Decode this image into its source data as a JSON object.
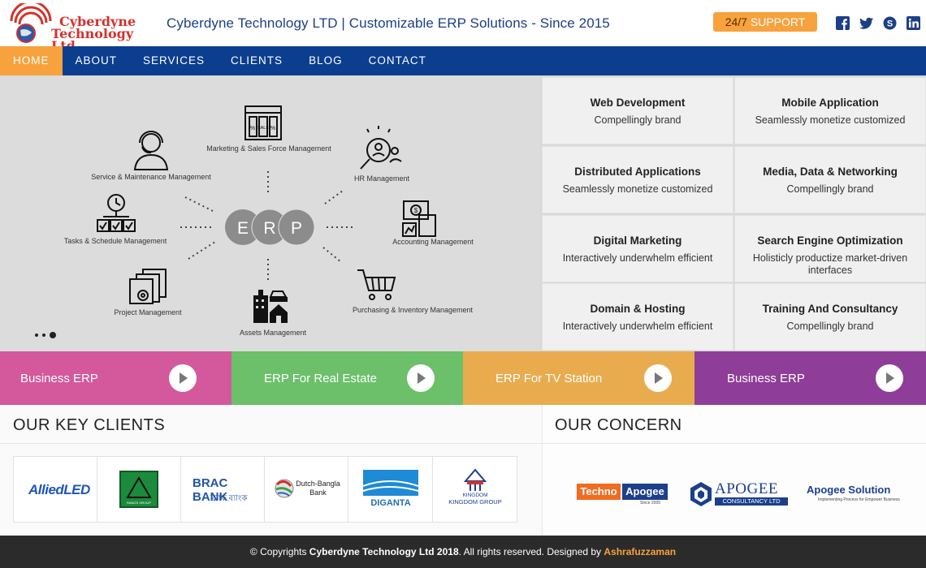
{
  "brand": {
    "name_line1": "Cyberdyne",
    "name_line2": "Technology Ltd.",
    "tagline": "Cyberdyne Technology LTD | Customizable ERP Solutions - Since 2015"
  },
  "support": {
    "prefix": "24/7",
    "label": "SUPPORT"
  },
  "social": [
    "facebook-icon",
    "twitter-icon",
    "skype-icon",
    "linkedin-icon"
  ],
  "nav": [
    {
      "label": "HOME",
      "active": true
    },
    {
      "label": "ABOUT"
    },
    {
      "label": "SERVICES"
    },
    {
      "label": "CLIENTS"
    },
    {
      "label": "BLOG"
    },
    {
      "label": "CONTACT"
    }
  ],
  "hero": {
    "center": [
      "E",
      "R",
      "P"
    ],
    "modules": [
      "Service & Maintenance Management",
      "Marketing & Sales Force Management",
      "HR Management",
      "Tasks & Schedule Management",
      "Accounting Management",
      "Project Management",
      "Assets Management",
      "Purchasing & Inventory Management"
    ]
  },
  "services": [
    {
      "title": "Web Development",
      "sub": "Compellingly brand"
    },
    {
      "title": "Mobile Application",
      "sub": "Seamlessly monetize customized"
    },
    {
      "title": "Distributed Applications",
      "sub": "Seamlessly monetize customized"
    },
    {
      "title": "Media, Data & Networking",
      "sub": "Compellingly brand"
    },
    {
      "title": "Digital Marketing",
      "sub": "Interactively underwhelm efficient"
    },
    {
      "title": "Search Engine Optimization",
      "sub": "Holisticly productize market-driven interfaces"
    },
    {
      "title": "Domain & Hosting",
      "sub": "Interactively underwhelm efficient"
    },
    {
      "title": "Training And Consultancy",
      "sub": "Compellingly brand"
    }
  ],
  "categories": [
    {
      "label": "Business ERP",
      "color": "#d3599c"
    },
    {
      "label": "ERP For Real Estate",
      "color": "#6cc06a"
    },
    {
      "label": "ERP For TV Station",
      "color": "#e8ac4e"
    },
    {
      "label": "Business ERP",
      "color": "#8e3d98"
    }
  ],
  "clients": {
    "title": "OUR KEY CLIENTS",
    "logos": [
      "AlliedLED",
      "RANGS GROUP",
      "BRAC BANK",
      "Dutch-Bangla Bank",
      "DIGANTA",
      "KINGDOM GROUP"
    ],
    "brac_sub": "ব্র্যাক ব্যাংক",
    "kingdom_sub": "KINGDOM"
  },
  "concern": {
    "title": "OUR CONCERN",
    "logos": [
      {
        "a": "Techno",
        "b": "Apogee",
        "sub": "Since 2005"
      },
      {
        "a": "APOGEE",
        "b": "CONSULTANCY LTD"
      },
      {
        "a": "Apogee Solution",
        "b": "Implementing Process for Empower Business"
      }
    ]
  },
  "footer": {
    "prefix": "© Copyrights ",
    "company": "Cyberdyne Technology Ltd 2018",
    "middle": ". All rights reserved. Designed by ",
    "designer": "Ashrafuzzaman"
  },
  "colors": {
    "navy": "#0b3e8f",
    "orange": "#f7a23d",
    "red": "#d6312b"
  }
}
